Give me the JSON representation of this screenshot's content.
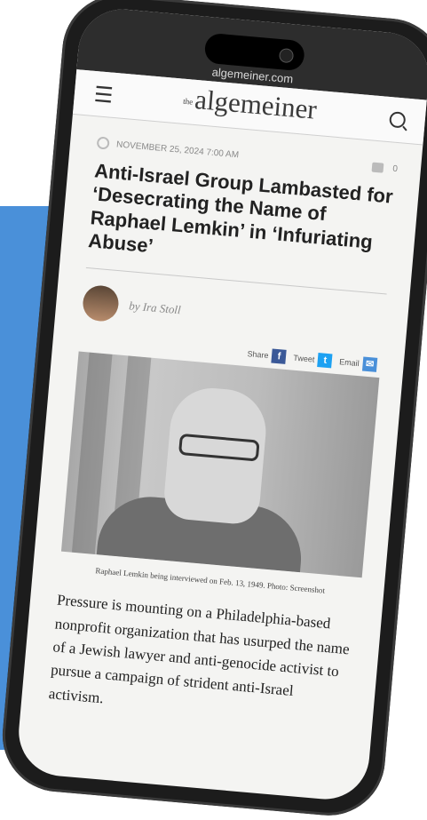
{
  "browser": {
    "url": "algemeiner.com"
  },
  "site": {
    "logo_prefix": "the",
    "logo": "algemeiner"
  },
  "article": {
    "date": "NOVEMBER 25, 2024 7:00 AM",
    "comment_count": "0",
    "headline": "Anti-Israel Group Lambasted for ‘Desecrating the Name of Raphael Lemkin’ in ‘Infuriating Abuse’",
    "byline": "by Ira Stoll",
    "share": {
      "share_label": "Share",
      "tweet_label": "Tweet",
      "email_label": "Email"
    },
    "caption": "Raphael Lemkin being interviewed on Feb. 13, 1949. Photo: Screenshot",
    "body": "Pressure is mounting on a Philadelphia-based nonprofit organization that has usurped the name of a Jewish lawyer and anti-genocide activist to pursue a campaign of strident anti-Israel activism."
  },
  "icons": {
    "menu": "hamburger-menu-icon",
    "search": "search-icon",
    "clock": "clock-icon",
    "comment": "comment-icon",
    "facebook": "facebook-icon",
    "twitter": "twitter-icon",
    "email": "email-icon"
  },
  "colors": {
    "background_accent": "#4a90d9",
    "phone_frame": "#1c1c1c",
    "status_bar": "#2d2d2d",
    "facebook": "#3b5998",
    "twitter": "#1da1f2"
  }
}
